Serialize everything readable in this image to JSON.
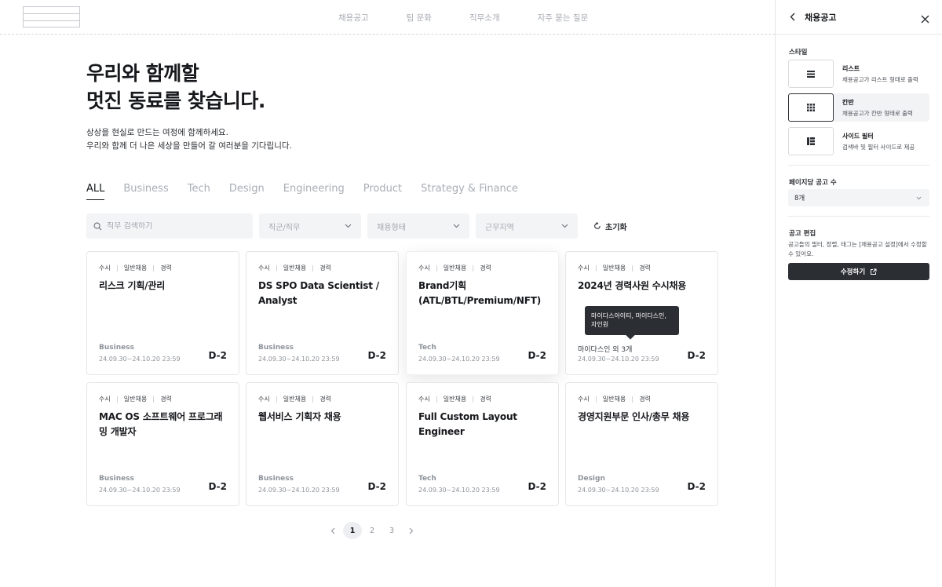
{
  "nav": {
    "links": [
      "채용공고",
      "팀 문화",
      "직무소개",
      "자주 묻는 질문"
    ]
  },
  "hero": {
    "title_line1": "우리와 함께할",
    "title_line2": "멋진 동료를 찾습니다.",
    "desc_line1": "상상을 현실로 만드는 여정에 함께하세요.",
    "desc_line2": "우리와 함께 더 나은 세상을 만들어 갈 여러분을 기다립니다."
  },
  "tabs": [
    "ALL",
    "Business",
    "Tech",
    "Design",
    "Engineering",
    "Product",
    "Strategy & Finance"
  ],
  "filters": {
    "search_placeholder": "직무 검색하기",
    "job_select": "직군/직무",
    "type_select": "채용형태",
    "location_select": "근무지역",
    "reset_label": "초기화"
  },
  "jobs": [
    {
      "meta": [
        "수시",
        "일반채용",
        "경력"
      ],
      "title": "리스크 기획/관리",
      "category": "Business",
      "date": "24.09.30~24.10.20 23:59",
      "dday": "D-2"
    },
    {
      "meta": [
        "수시",
        "일반채용",
        "경력"
      ],
      "title": "DS SPO Data Scientist / Analyst",
      "category": "Business",
      "date": "24.09.30~24.10.20 23:59",
      "dday": "D-2"
    },
    {
      "meta": [
        "수시",
        "일반채용",
        "경력"
      ],
      "title": "Brand기획(ATL/BTL/Premium/NFT)",
      "category": "Tech",
      "date": "24.09.30~24.10.20 23:59",
      "dday": "D-2"
    },
    {
      "meta": [
        "수시",
        "일반채용",
        "경력"
      ],
      "title": "2024년 경력사원 수시채용",
      "category": "마이다스인   외 3개",
      "date": "24.09.30~24.10.20 23:59",
      "dday": "D-2"
    },
    {
      "meta": [
        "수시",
        "일반채용",
        "경력"
      ],
      "title": "MAC OS 소프트웨어 프로그래밍 개발자",
      "category": "Business",
      "date": "24.09.30~24.10.20 23:59",
      "dday": "D-2"
    },
    {
      "meta": [
        "수시",
        "일반채용",
        "경력"
      ],
      "title": "웹서비스 기획자 채용",
      "category": "Business",
      "date": "24.09.30~24.10.20 23:59",
      "dday": "D-2"
    },
    {
      "meta": [
        "수시",
        "일반채용",
        "경력"
      ],
      "title": "Full Custom Layout Engineer",
      "category": "Tech",
      "date": "24.09.30~24.10.20 23:59",
      "dday": "D-2"
    },
    {
      "meta": [
        "수시",
        "일반채용",
        "경력"
      ],
      "title": "경영지원부문 인사/총무 채용",
      "category": "Design",
      "date": "24.09.30~24.10.20 23:59",
      "dday": "D-2"
    }
  ],
  "tooltip": "마이다스아이티, 마이다스인, 자인원",
  "pagination": [
    "1",
    "2",
    "3"
  ],
  "panel": {
    "title": "채용공고",
    "style_label": "스타일",
    "styles": [
      {
        "name": "리스트",
        "desc": "채용공고가 리스트 형태로 출력"
      },
      {
        "name": "칸반",
        "desc": "채용공고가 칸반 형태로 출력"
      },
      {
        "name": "사이드 필터",
        "desc": "검색바 및 필터 사이드로 제공"
      }
    ],
    "per_page_label": "페이지당 공고 수",
    "per_page_value": "8개",
    "edit_label": "공고 편집",
    "edit_desc": "공고들의 필터, 정렬, 태그는 [채용공고 설정]에서 수정할 수 있어요.",
    "edit_button": "수정하기"
  },
  "colors": {
    "primary_dark": "#2b2e33",
    "muted": "#a9adb4"
  }
}
